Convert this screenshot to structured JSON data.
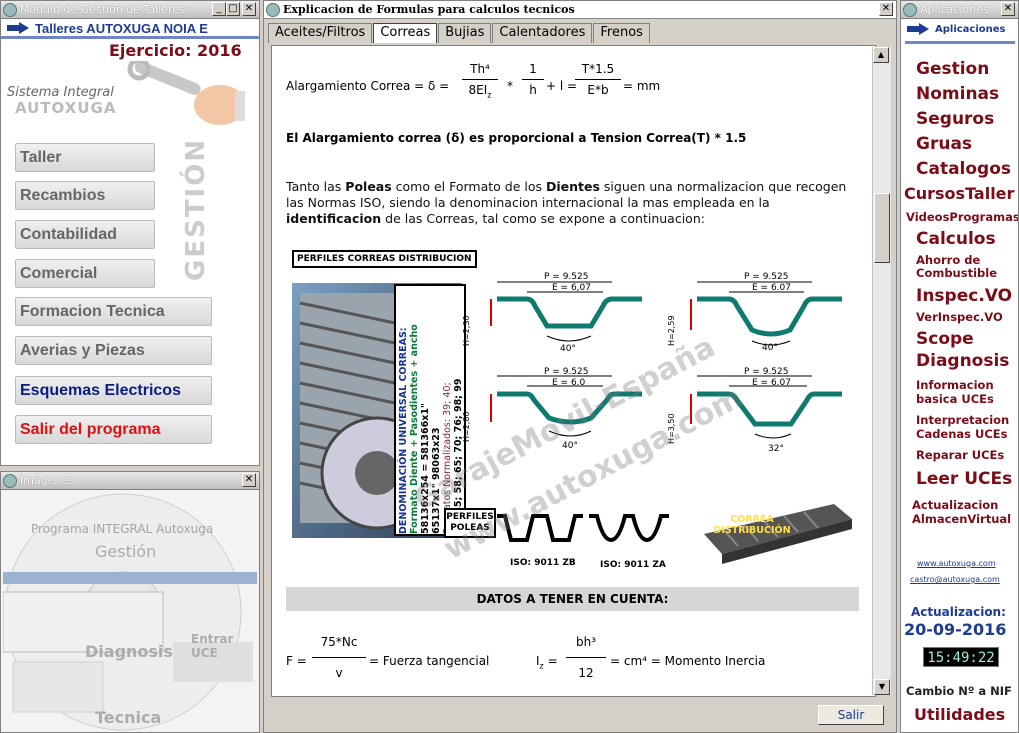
{
  "left_window": {
    "title": "Módulo de Gestión de Talleres",
    "header": "Talleres AUTOXUGA NOIA E",
    "ejercicio": "Ejercicio: 2016",
    "logo_line1": "Sistema Integral",
    "logo_line2": "AUTOXUGA",
    "side_label": "GESTIÓN",
    "menu": [
      "Taller",
      "Recambios",
      "Contabilidad",
      "Comercial",
      "Formacion Tecnica",
      "Averias y Piezas",
      "Esquemas Electricos",
      "Salir del programa"
    ]
  },
  "images_window": {
    "title": "Imágenes",
    "collage_texts": [
      "Programa INTEGRAL Autoxuga",
      "Gestión",
      "Diagnosis",
      "Tecnica",
      "Entrar UCE"
    ]
  },
  "main_window": {
    "title": "Explicacion de Formulas para calculos tecnicos",
    "tabs": [
      "Aceites/Filtros",
      "Correas",
      "Bujias",
      "Calentadores",
      "Frenos"
    ],
    "active_tab": "Correas",
    "formula1": {
      "prefix": "Alargamiento Correa = δ =",
      "num1": "Th⁴",
      "den1": "8EI",
      "star": "*",
      "num2": "1",
      "den2": "h",
      "plus": "+ l =",
      "num3": "T*1.5",
      "den3": "E*b",
      "unit": "= mm"
    },
    "bold_line": "El Alargamiento correa (δ) es proporcional a Tension Correa(T) * 1.5",
    "paragraph": {
      "p1": "Tanto las ",
      "b1": "Poleas",
      "p2": " como el Formato de los ",
      "b2": "Dientes",
      "p3": " siguen una normalizacion que recogen las Normas ISO, siendo la denominacion internacional la mas empleada en la ",
      "b3": "identificacion",
      "p4": " de las Correas, tal como se expone a continuacion:"
    },
    "diagram": {
      "perfiles_title": "PERFILES CORREAS DISTRIBUCION",
      "vertical_box": [
        "DENOMINACIÓN UNIVERSAL CORREAS:",
        "Formato Diente + Pasodientes + ancho",
        "58136x254 = 581366x1\"",
        "65137x1\"   98063x23",
        "Formatos Normalizados: 39; 40;",
        "41; 45; 58; 65; 70; 76; 98; 99"
      ],
      "profile_labels": [
        {
          "p": "P = 9.525",
          "e": "E = 6,07",
          "h": "H=2,30",
          "a": "40°"
        },
        {
          "p": "P = 9.525",
          "e": "E = 6.07",
          "h": "H=2,59",
          "a": "40°"
        },
        {
          "p": "P = 9.525",
          "e": "E = 6.0",
          "h": "H=2,80",
          "a": "40°"
        },
        {
          "p": "P = 9.525",
          "e": "E = 6.07",
          "h": "H=3,50",
          "a": "32°"
        }
      ],
      "poleas_label": "PERFILES POLEAS",
      "iso_zb": "ISO: 9011 ZB",
      "iso_za": "ISO: 9011 ZA",
      "correa_label": "CORREA DISTRIBUCIÓN",
      "watermark1": "GarajeMovil-España",
      "watermark2": "www.autoxuga.com"
    },
    "datos_header": "DATOS A TENER EN CUENTA:",
    "formula2": {
      "f_lhs": "F =",
      "f_num": "75*Nc",
      "f_den": "v",
      "f_rhs": "= Fuerza tangencial",
      "i_lhs": "I",
      "i_sub": "z",
      "i_eq": "=",
      "i_num": "bh³",
      "i_den": "12",
      "i_rhs": "= cm⁴ = Momento Inercia"
    },
    "salir_button": "Salir"
  },
  "right_window": {
    "title": "Aplicaciones",
    "header": "Aplicaciones",
    "items": [
      {
        "label": "Gestion",
        "size": "big"
      },
      {
        "label": "Nominas",
        "size": "big"
      },
      {
        "label": "Seguros",
        "size": "big"
      },
      {
        "label": "Gruas",
        "size": "big"
      },
      {
        "label": "Catalogos",
        "size": "big"
      },
      {
        "label": "CursosTaller",
        "size": "big"
      },
      {
        "label": "VideosProgramas",
        "size": "mid"
      },
      {
        "label": "Calculos",
        "size": "big"
      },
      {
        "label": "Ahorro de Combustible",
        "size": "small"
      },
      {
        "label": "Inspec.VO",
        "size": "big"
      },
      {
        "label": "VerInspec.VO",
        "size": "small"
      },
      {
        "label": "Scope",
        "size": "big"
      },
      {
        "label": "Diagnosis",
        "size": "big"
      },
      {
        "label": "Informacion basica UCEs",
        "size": "small"
      },
      {
        "label": "Interpretacion Cadenas UCEs",
        "size": "small"
      },
      {
        "label": "Reparar UCEs",
        "size": "small"
      },
      {
        "label": "Leer UCEs",
        "size": "big"
      },
      {
        "label": "Actualizacion AlmacenVirtual",
        "size": "small"
      }
    ],
    "link1": "www.autoxuga.com",
    "link2": "castro@autoxuga.com",
    "actualizacion_label": "Actualizacion:",
    "actualizacion_date": "20-09-2016",
    "clock": "15:49:22",
    "cambio": "Cambio Nº a NIF",
    "utilidades": "Utilidades"
  },
  "colors": {
    "maroon": "#7a0d18",
    "navy": "#1c3b93",
    "teal": "#0f7a70"
  }
}
